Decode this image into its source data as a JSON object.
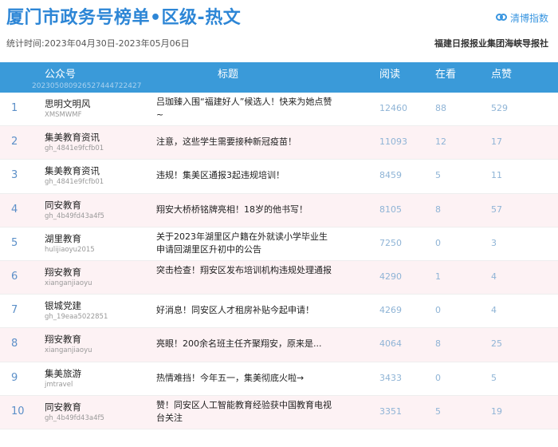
{
  "header": {
    "title": "厦门市政务号榜单•区级-热文",
    "period": "统计时间:2023年04月30日-2023年05月06日",
    "logo_text": "清博指数",
    "publisher": "福建日报报业集团海峡导报社"
  },
  "table": {
    "columns": [
      "公众号",
      "标题",
      "阅读",
      "在看",
      "点赞"
    ],
    "header_code": "20230508092652744472242​7",
    "rows": [
      {
        "rank": "1",
        "name": "思明文明风",
        "account": "XMSMWMF",
        "title": "吕珈臻入围“福建好人”候选人！快来为她点赞~",
        "read": "12460",
        "looking": "88",
        "likes": "529"
      },
      {
        "rank": "2",
        "name": "集美教育资讯",
        "account": "gh_4841e9fcfb01",
        "title": "注意，这些学生需要接种新冠疫苗！",
        "read": "11093",
        "looking": "12",
        "likes": "17"
      },
      {
        "rank": "3",
        "name": "集美教育资讯",
        "account": "gh_4841e9fcfb01",
        "title": "违规！集美区通报3起违规培训！",
        "read": "8459",
        "looking": "5",
        "likes": "11"
      },
      {
        "rank": "4",
        "name": "同安教育",
        "account": "gh_4b49fd43a4f5",
        "title": "翔安大桥桥铭牌亮相！18岁的他书写！",
        "read": "8105",
        "looking": "8",
        "likes": "57"
      },
      {
        "rank": "5",
        "name": "湖里教育",
        "account": "hulijiaoyu2015",
        "title": "关于2023年湖里区户籍在外就读小学毕业生 申请回湖里区升初中的公告",
        "read": "7250",
        "looking": "0",
        "likes": "3"
      },
      {
        "rank": "6",
        "name": "翔安教育",
        "account": "xianganjiaoyu",
        "title": "突击检查！翔安区发布培训机构违规处理通报",
        "read": "4290",
        "looking": "1",
        "likes": "4"
      },
      {
        "rank": "7",
        "name": "银城党建",
        "account": "gh_19eaa5022851",
        "title": "好消息！同安区人才租房补贴今起申请！",
        "read": "4269",
        "looking": "0",
        "likes": "4"
      },
      {
        "rank": "8",
        "name": "翔安教育",
        "account": "xianganjiaoyu",
        "title": "亮眼！200余名班主任齐聚翔安，原来是...",
        "read": "4064",
        "looking": "8",
        "likes": "25"
      },
      {
        "rank": "9",
        "name": "集美旅游",
        "account": "jmtravel",
        "title": "热情难挡！今年五一，集美彻底火啦→",
        "read": "3433",
        "looking": "0",
        "likes": "5"
      },
      {
        "rank": "10",
        "name": "同安教育",
        "account": "gh_4b49fd43a4f5",
        "title": "赞！同安区人工智能教育经验获中国教育电视台关注",
        "read": "3351",
        "looking": "5",
        "likes": "19"
      }
    ]
  }
}
